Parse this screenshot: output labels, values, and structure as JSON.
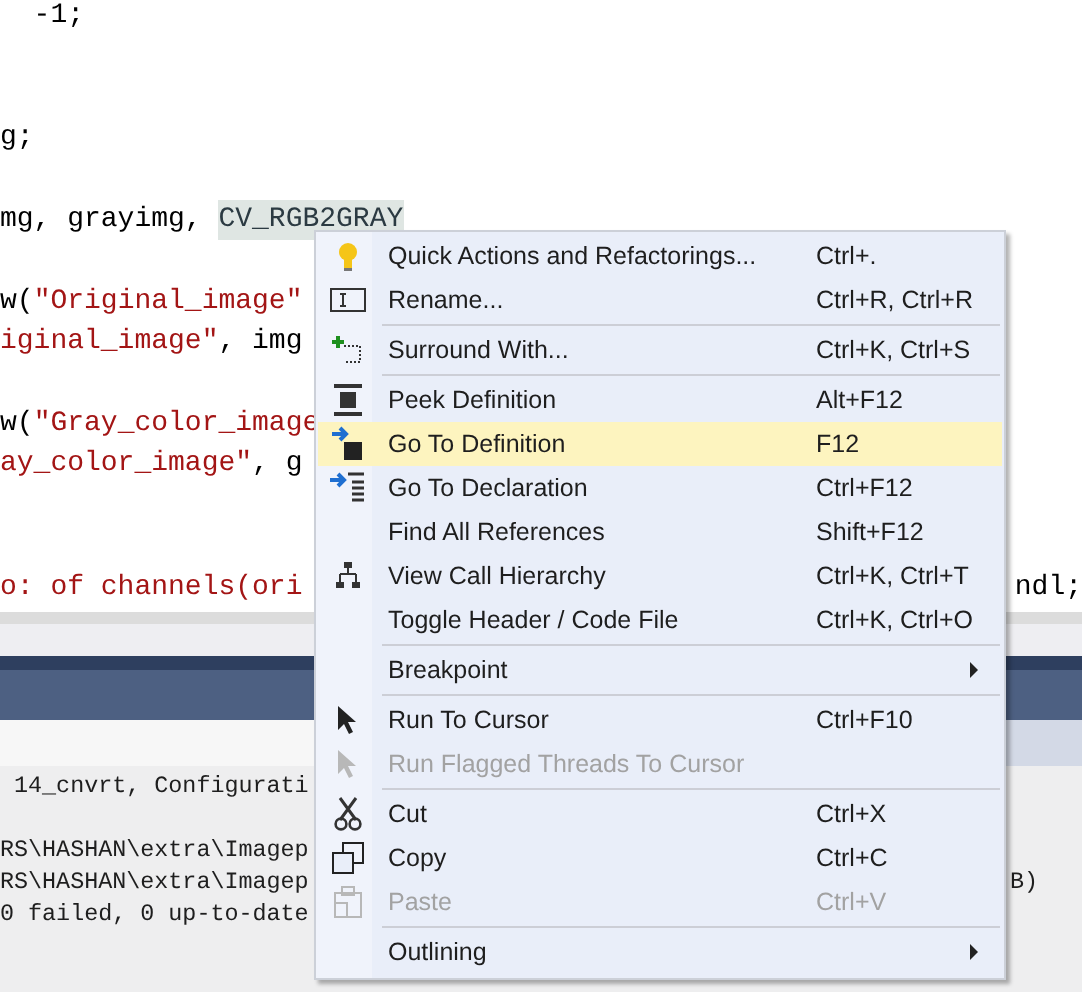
{
  "editor": {
    "lines": [
      {
        "segments": [
          {
            "text": "  -1;",
            "kind": "plain"
          }
        ]
      },
      {
        "segments": [
          {
            "text": "g;",
            "kind": "plain"
          }
        ]
      },
      {
        "segments": [
          {
            "text": "mg, grayimg, ",
            "kind": "plain"
          },
          {
            "text": "CV_RGB2GRAY",
            "kind": "highlight"
          }
        ]
      },
      {
        "segments": [
          {
            "text": "w(",
            "kind": "plain"
          },
          {
            "text": "\"Original_image\"",
            "kind": "string"
          }
        ]
      },
      {
        "segments": [
          {
            "text": "iginal_image\"",
            "kind": "string"
          },
          {
            "text": ", img",
            "kind": "plain"
          }
        ]
      },
      {
        "segments": [
          {
            "text": "w(",
            "kind": "plain"
          },
          {
            "text": "\"Gray_color_image",
            "kind": "string"
          }
        ]
      },
      {
        "segments": [
          {
            "text": "ay_color_image\"",
            "kind": "string"
          },
          {
            "text": ", g",
            "kind": "plain"
          }
        ]
      },
      {
        "segments": [
          {
            "text": "o: of channels(ori",
            "kind": "string"
          }
        ],
        "tail": "ndl;"
      }
    ]
  },
  "output": {
    "lines": [
      {
        "text": " 14_cnvrt, Configurati"
      },
      {
        "text": "RS\\HASHAN\\extra\\Imagep"
      },
      {
        "text": "RS\\HASHAN\\extra\\Imagep",
        "tail": "B)"
      },
      {
        "text": "0 failed, 0 up-to-date"
      }
    ]
  },
  "context_menu": {
    "items": [
      {
        "kind": "item",
        "label": "Quick Actions and Refactorings...",
        "shortcut": "Ctrl+.",
        "disabled": false,
        "selected": false,
        "submenu": false
      },
      {
        "kind": "item",
        "label": "Rename...",
        "shortcut": "Ctrl+R, Ctrl+R",
        "disabled": false,
        "selected": false,
        "submenu": false
      },
      {
        "kind": "separator"
      },
      {
        "kind": "item",
        "label": "Surround With...",
        "shortcut": "Ctrl+K, Ctrl+S",
        "disabled": false,
        "selected": false,
        "submenu": false
      },
      {
        "kind": "separator"
      },
      {
        "kind": "item",
        "label": "Peek Definition",
        "shortcut": "Alt+F12",
        "disabled": false,
        "selected": false,
        "submenu": false
      },
      {
        "kind": "item",
        "label": "Go To Definition",
        "shortcut": "F12",
        "disabled": false,
        "selected": true,
        "submenu": false
      },
      {
        "kind": "item",
        "label": "Go To Declaration",
        "shortcut": "Ctrl+F12",
        "disabled": false,
        "selected": false,
        "submenu": false
      },
      {
        "kind": "item",
        "label": "Find All References",
        "shortcut": "Shift+F12",
        "disabled": false,
        "selected": false,
        "submenu": false
      },
      {
        "kind": "item",
        "label": "View Call Hierarchy",
        "shortcut": "Ctrl+K, Ctrl+T",
        "disabled": false,
        "selected": false,
        "submenu": false
      },
      {
        "kind": "item",
        "label": "Toggle Header / Code File",
        "shortcut": "Ctrl+K, Ctrl+O",
        "disabled": false,
        "selected": false,
        "submenu": false
      },
      {
        "kind": "separator"
      },
      {
        "kind": "item",
        "label": "Breakpoint",
        "disabled": false,
        "selected": false,
        "submenu": true
      },
      {
        "kind": "separator"
      },
      {
        "kind": "item",
        "label": "Run To Cursor",
        "shortcut": "Ctrl+F10",
        "disabled": false,
        "selected": false,
        "submenu": false
      },
      {
        "kind": "item",
        "label": "Run Flagged Threads To Cursor",
        "disabled": true,
        "selected": false,
        "submenu": false
      },
      {
        "kind": "separator"
      },
      {
        "kind": "item",
        "label": "Cut",
        "shortcut": "Ctrl+X",
        "disabled": false,
        "selected": false,
        "submenu": false
      },
      {
        "kind": "item",
        "label": "Copy",
        "shortcut": "Ctrl+C",
        "disabled": false,
        "selected": false,
        "submenu": false
      },
      {
        "kind": "item",
        "label": "Paste",
        "shortcut": "Ctrl+V",
        "disabled": true,
        "selected": false,
        "submenu": false
      },
      {
        "kind": "separator"
      },
      {
        "kind": "item",
        "label": "Outlining",
        "disabled": false,
        "selected": false,
        "submenu": true
      }
    ]
  }
}
